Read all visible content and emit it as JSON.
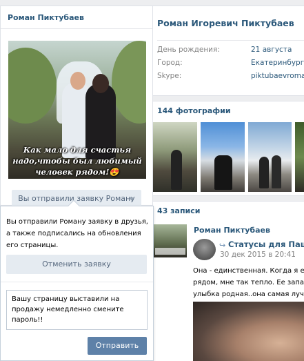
{
  "profile": {
    "header_name": "Роман Пиктубаев",
    "avatar_caption": "Как мало для счастья надо,чтобы был любимый человек рядом!😍",
    "status_button": "Вы отправили заявку Роману"
  },
  "popup": {
    "text": "Вы отправили Роману заявку в друзья, а также подписались на обновления его страницы.",
    "cancel_label": "Отменить заявку",
    "message_value": "Вашу страницу выставили на продажу немедленно смените пароль!!",
    "send_label": "Отправить"
  },
  "info": {
    "full_name": "Роман Игоревич Пиктубаев",
    "rows": [
      {
        "label": "День рождения:",
        "value": "21 августа"
      },
      {
        "label": "Город:",
        "value": "Екатеринбург"
      },
      {
        "label": "Skype:",
        "value": "piktubaevroman"
      }
    ]
  },
  "photos": {
    "header": "144 фотографии"
  },
  "posts": {
    "header": "43 записи",
    "author": "Роман Пиктубаев",
    "repost_icon": "repost-arrow-icon",
    "repost_source": "Статусы для Пацан",
    "date": "30 дек 2015 в 20:41",
    "text_lines": [
      "Она - единственная. Когда я ее",
      "рядом, мне так тепло. Ее запах",
      "улыбка родная..она самая лучш"
    ]
  },
  "colors": {
    "link": "#2b587a",
    "button_bg": "#e5ebf1",
    "button_text": "#55677d",
    "primary_button": "#5e81a8",
    "page_bg": "#edeef0"
  }
}
